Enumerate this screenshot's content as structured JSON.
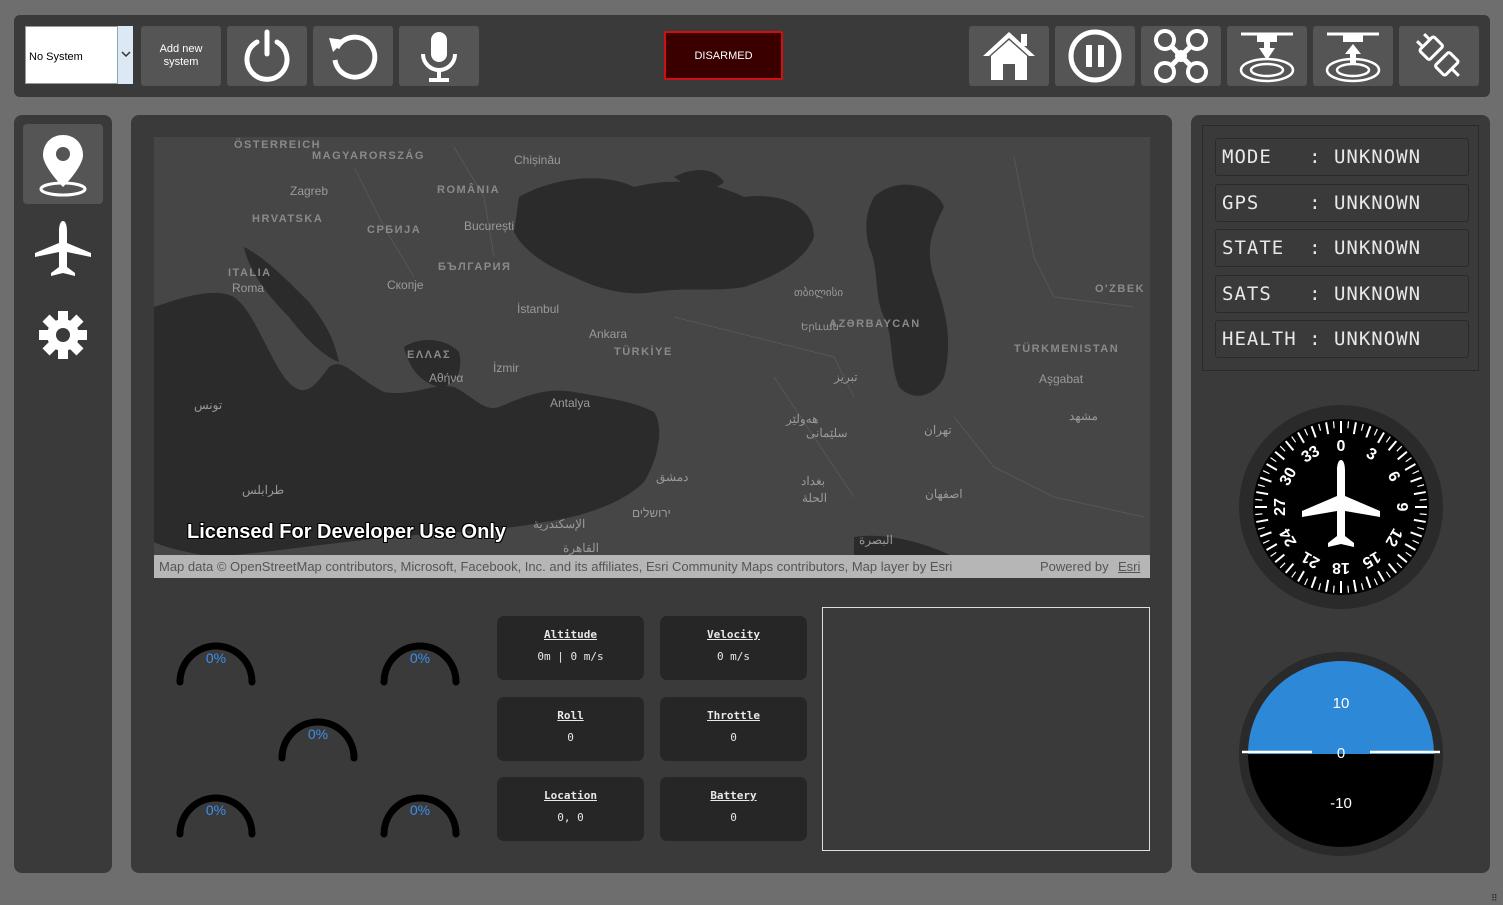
{
  "toolbar": {
    "system_select_value": "No System",
    "add_system_label": "Add new\nsystem",
    "arm_status": "DISARMED"
  },
  "status": {
    "mode": "MODE   : UNKNOWN",
    "gps": "GPS    : UNKNOWN",
    "state": "STATE  : UNKNOWN",
    "sats": "SATS   : UNKNOWN",
    "health": "HEALTH : UNKNOWN"
  },
  "map": {
    "watermark": "Licensed For Developer Use Only",
    "attribution": "Map data © OpenStreetMap contributors, Microsoft, Facebook, Inc. and its affiliates, Esri Community Maps contributors, Map layer by Esri",
    "powered_by": "Powered by",
    "powered_link": "Esri",
    "labels": {
      "osterreich": "ÖSTERREICH",
      "magyar": "MAGYARORSZÁG",
      "chisinau": "Chișinău",
      "zagreb": "Zagreb",
      "romania": "ROMÂNIA",
      "hrvatska": "HRVATSKA",
      "srbija": "СРБИЈА",
      "bucuresti": "București",
      "italia": "ITALIA",
      "bulgaria": "БЪЛГАРИЯ",
      "roma": "Roma",
      "skopje": "Скопје",
      "istanbul": "İstanbul",
      "tbilisi": "თბილისი",
      "ankara": "Ankara",
      "yerevan": "Երևան",
      "azerbaycan": "AZƏRBAYCAN",
      "ozbek": "O'ZBEK",
      "ellas": "ΕΛΛΑΣ",
      "turkiye": "TÜRKİYE",
      "turkmenistan": "TÜRKMENISTAN",
      "athina": "Αθήνα",
      "izmir": "İzmir",
      "tabriz": "تبریز",
      "asgabat": "Aşgabat",
      "tunis": "تونس",
      "antalya": "Antalya",
      "mashhad": "مشهد",
      "mosul": "هەولێر",
      "sulaymaniyah": "سلێمانی",
      "tehran": "تهران",
      "damascus": "دمشق",
      "baghdad": "بغداد",
      "hillah": "الحلة",
      "tripoli": "طرابلس",
      "isfahan": "اصفهان",
      "jerusalem": "ירושלים",
      "alexandria": "الإسكندرية",
      "basra": "البصرة",
      "cairo": "القاهرة"
    }
  },
  "gauges": [
    "0%",
    "0%",
    "0%",
    "0%",
    "0%"
  ],
  "telemetry": {
    "altitude": {
      "title": "Altitude",
      "value": "0m | 0 m/s"
    },
    "velocity": {
      "title": "Velocity",
      "value": "0 m/s"
    },
    "roll": {
      "title": "Roll",
      "value": "0"
    },
    "throttle": {
      "title": "Throttle",
      "value": "0"
    },
    "location": {
      "title": "Location",
      "value": "0, 0"
    },
    "battery": {
      "title": "Battery",
      "value": "0"
    }
  },
  "compass": {
    "heading_deg": 0,
    "labels": [
      "0",
      "3",
      "6",
      "9",
      "12",
      "15",
      "18",
      "21",
      "24",
      "27",
      "30",
      "33"
    ]
  },
  "attitude": {
    "pitch_deg": 0,
    "roll_deg": 0,
    "marks": [
      "10",
      "0",
      "-10"
    ],
    "sky_color": "#2e88d8",
    "ground_color": "#000000"
  },
  "colors": {
    "background": "#6e6e6e",
    "panel": "#3a3a3a",
    "button": "#555555",
    "armed_status_bg": "#3a0000",
    "armed_status_border": "#d01010",
    "gauge_text": "#3b8ff0"
  },
  "icons": {
    "power": "power-icon",
    "reset": "reset-icon",
    "mic": "microphone-icon",
    "home": "home-icon",
    "pause": "pause-icon",
    "drone": "drone-icon",
    "land": "land-icon",
    "takeoff": "takeoff-icon",
    "disconnect": "disconnect-icon"
  }
}
